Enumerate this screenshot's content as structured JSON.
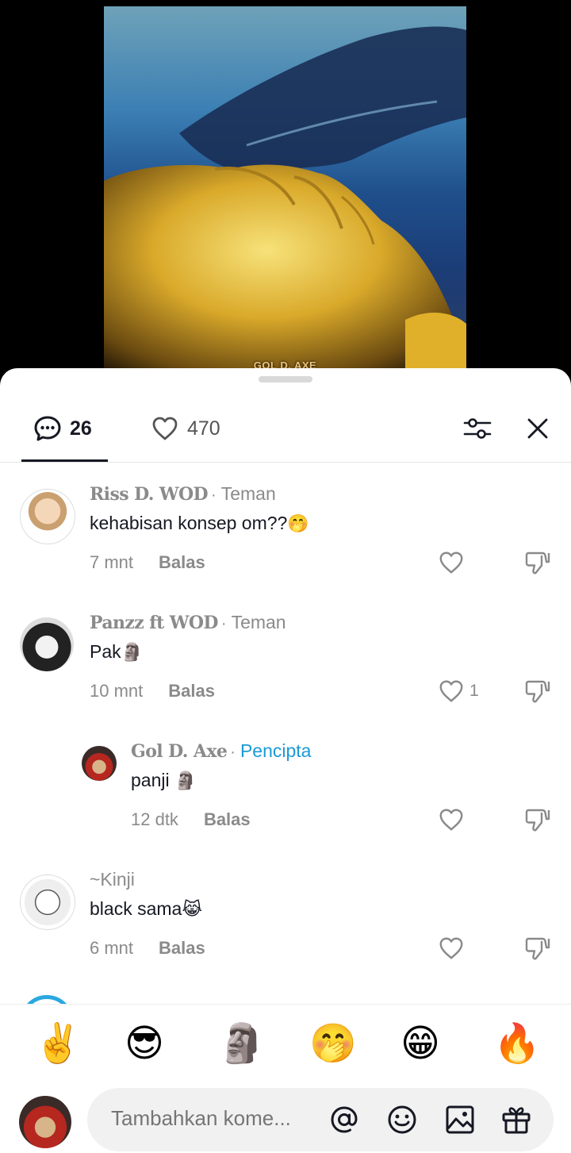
{
  "video": {
    "watermark": "GOL D. AXE"
  },
  "tabs": {
    "comments_count": "26",
    "likes_count": "470"
  },
  "comments": [
    {
      "username": "Riss D. WOD",
      "tag": "Teman",
      "text": "kehabisan konsep om??",
      "emoji": "🤭",
      "time": "7 mnt",
      "reply_label": "Balas",
      "likes": ""
    },
    {
      "username": "Panzz ft WOD",
      "tag": "Teman",
      "text": "Pak",
      "emoji": "🗿",
      "time": "10 mnt",
      "reply_label": "Balas",
      "likes": "1"
    },
    {
      "username": "Gol D. Axe",
      "tag": "Pencipta",
      "text": "panji ",
      "emoji": "🗿",
      "time": "12 dtk",
      "reply_label": "Balas",
      "likes": ""
    },
    {
      "username": "~Kinji",
      "tag": "",
      "text": "black sama",
      "emoji": "😹",
      "time": "6 mnt",
      "reply_label": "Balas",
      "likes": ""
    }
  ],
  "quick_emojis": [
    "✌️",
    "😎",
    "🗿",
    "🤭",
    "😁",
    "🔥"
  ],
  "input": {
    "placeholder": "Tambahkan kome..."
  },
  "colors": {
    "creator_tag": "#1b9ad6",
    "text_primary": "#161823",
    "text_secondary": "#8a8a8a"
  }
}
